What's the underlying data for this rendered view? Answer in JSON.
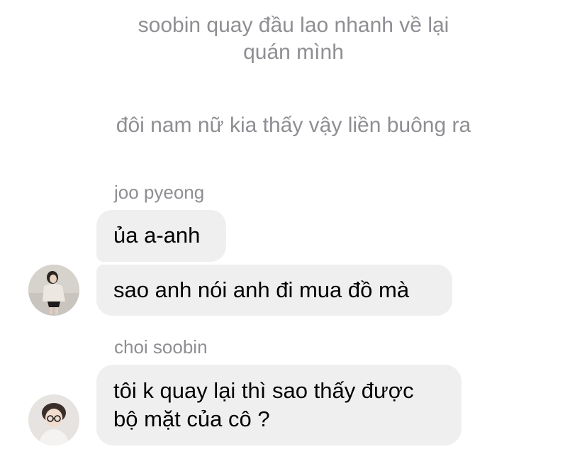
{
  "narration": [
    "soobin quay đầu lao nhanh về lại\nquán mình",
    "đôi nam nữ kia thấy vậy liền buông ra"
  ],
  "conversation": [
    {
      "sender": "joo pyeong",
      "avatar_icon": "girl-photo-avatar",
      "messages": [
        "ủa a-anh",
        "sao anh nói anh đi mua đồ mà"
      ]
    },
    {
      "sender": "choi soobin",
      "avatar_icon": "boy-photo-avatar",
      "messages": [
        [
          "tôi k quay lại thì sao thấy được",
          "bộ mặt của cô ?"
        ]
      ]
    }
  ],
  "colors": {
    "narration_text": "#8e8e93",
    "bubble_background": "#efefef",
    "message_text": "#000000"
  }
}
